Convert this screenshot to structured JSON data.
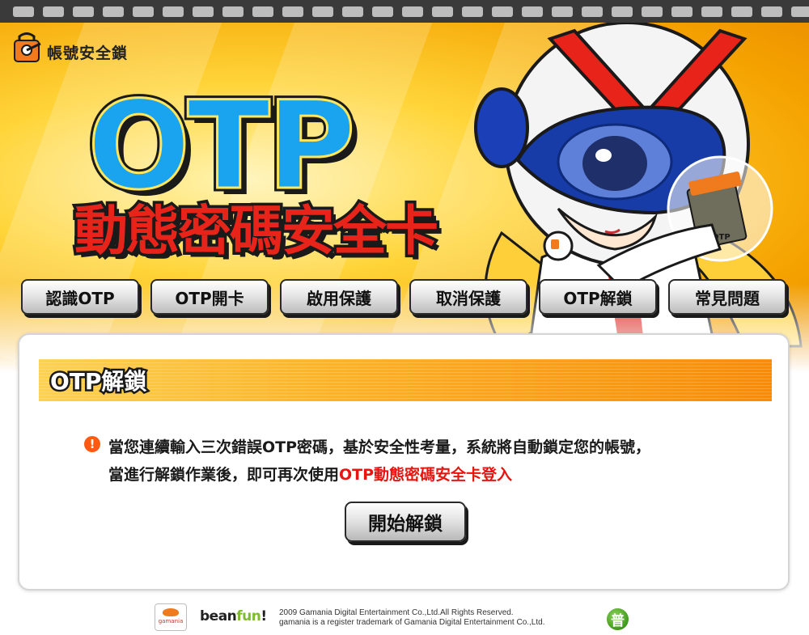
{
  "brand": {
    "logo_text": "帳號安全鎖"
  },
  "banner": {
    "title": "OTP",
    "subtitle": "動態密碼安全卡",
    "card_label": "OTP"
  },
  "nav": {
    "items": [
      {
        "label": "認識OTP"
      },
      {
        "label": "OTP開卡"
      },
      {
        "label": "啟用保護"
      },
      {
        "label": "取消保護"
      },
      {
        "label": "OTP解鎖"
      },
      {
        "label": "常見問題"
      }
    ]
  },
  "section": {
    "title": "OTP解鎖",
    "notice_icon": "!",
    "line1": "當您連續輸入三次錯誤OTP密碼，基於安全性考量，系統將自動鎖定您的帳號，",
    "line2_prefix": "當進行解鎖作業後，即可再次使用",
    "line2_highlight": "OTP動態密碼安全卡登入",
    "start_button": "開始解鎖"
  },
  "footer": {
    "gamania_text": "gamania",
    "beanfun_bean": "bean",
    "beanfun_fun": "fun",
    "beanfun_mark": "!",
    "copyright_line1": "2009 Gamania Digital Entertainment Co.,Ltd.All Rights Reserved.",
    "copyright_line2": "gamania is a register trademark of Gamania Digital Entertainment Co.,Ltd.",
    "rating_label": "普"
  },
  "colors": {
    "accent_orange": "#ff8a00",
    "highlight_red": "#e8140f",
    "otp_blue": "#1aa3ee",
    "rating_green": "#3f9a1c"
  }
}
